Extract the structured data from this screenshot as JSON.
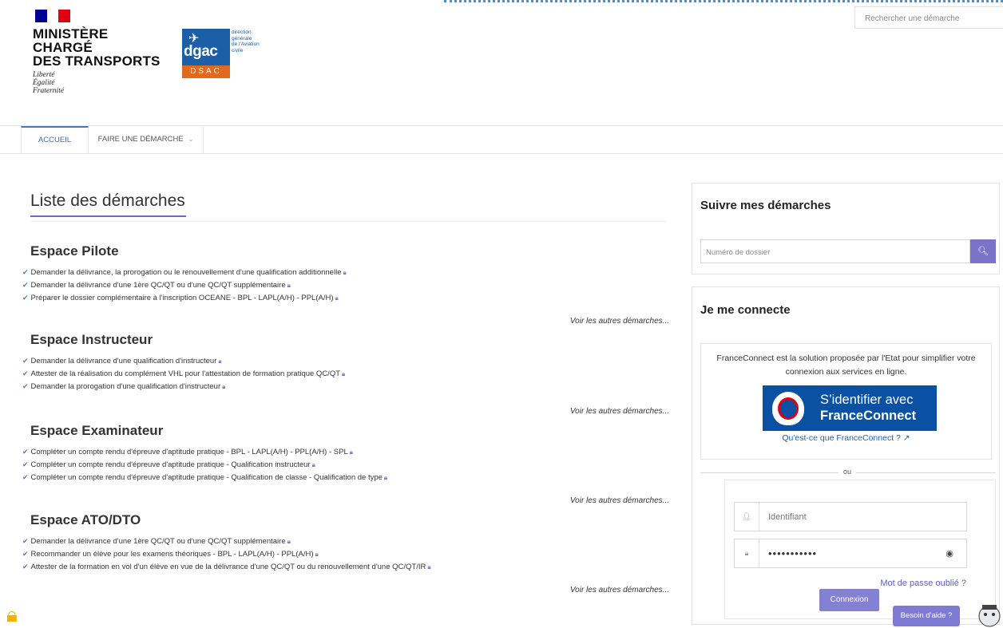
{
  "header": {
    "ministry_line1": "MINISTÈRE",
    "ministry_line2": "CHARGÉ",
    "ministry_line3": "DES TRANSPORTS",
    "motto1": "Liberté",
    "motto2": "Égalité",
    "motto3": "Fraternité",
    "dgac_logo_text": "dgac",
    "dgac_side1": "direction",
    "dgac_side2": "générale",
    "dgac_side3": "de l'Aviation",
    "dgac_side4": "civile",
    "dsac_text": "DSAC",
    "search_placeholder": "Rechercher une démarche"
  },
  "nav": {
    "tabs": [
      {
        "label": "ACCUEIL",
        "active": true
      },
      {
        "label": "FAIRE UNE DÉMARCHE",
        "active": false
      }
    ]
  },
  "main": {
    "title": "Liste des démarches",
    "sections": [
      {
        "title": "Espace Pilote",
        "items": [
          "Demander la délivrance, la prorogation ou le renouvellement d'une qualification additionnelle",
          "Demander la délivrance d'une 1ère QC/QT ou d'une QC/QT supplémentaire",
          "Préparer le dossier complémentaire à l'inscription OCEANE - BPL - LAPL(A/H) - PPL(A/H)"
        ],
        "more": "Voir les autres démarches..."
      },
      {
        "title": "Espace Instructeur",
        "items": [
          "Demander la délivrance d'une qualification d'instructeur",
          "Attester de la réalisation du complément VHL pour l'attestation de formation pratique QC/QT",
          "Demander la prorogation d'une qualification d'instructeur"
        ],
        "more": "Voir les autres démarches..."
      },
      {
        "title": "Espace Examinateur",
        "items": [
          "Compléter un compte rendu d'épreuve d'aptitude pratique - BPL - LAPL(A/H) - PPL(A/H) - SPL",
          "Compléter un compte rendu d'épreuve d'aptitude pratique - Qualification instructeur",
          "Compléter un compte rendu d'épreuve d'aptitude pratique - Qualification de classe - Qualification de type"
        ],
        "more": "Voir les autres démarches..."
      },
      {
        "title": "Espace ATO/DTO",
        "items": [
          "Demander la délivrance d'une 1ère QC/QT ou d'une QC/QT supplémentaire",
          "Recommander un élève pour les examens théoriques - BPL - LAPL(A/H) - PPL(A/H)",
          "Attester de la formation en vol d'un élève en vue de la délivrance d'une QC/QT ou du renouvellement d'une QC/QT/IR"
        ],
        "more": "Voir les autres démarches..."
      }
    ]
  },
  "suivre": {
    "title": "Suivre mes démarches",
    "dossier_placeholder": "Numéro de dossier"
  },
  "connect": {
    "title": "Je me connecte",
    "fc_text": "FranceConnect est la solution proposée par l'Etat pour simplifier votre connexion aux services en ligne.",
    "fc_btn_line1": "S’identifier avec",
    "fc_btn_line2": "FranceConnect",
    "fc_what": "Qu'est-ce que FranceConnect ?",
    "or": "ou",
    "identifiant_placeholder": "Identifiant",
    "password_value": "•••••••••••",
    "forgot": "Mot de passe oublié ?",
    "login_button": "Connexion"
  },
  "help_button": "Besoin d'aide ?",
  "colors": {
    "accent": "#7b73c9",
    "nav_active": "#4973c8",
    "franceconnect_blue": "#0a51a3",
    "dgac_blue": "#1d5fa6",
    "dsac_orange": "#e0691f"
  }
}
